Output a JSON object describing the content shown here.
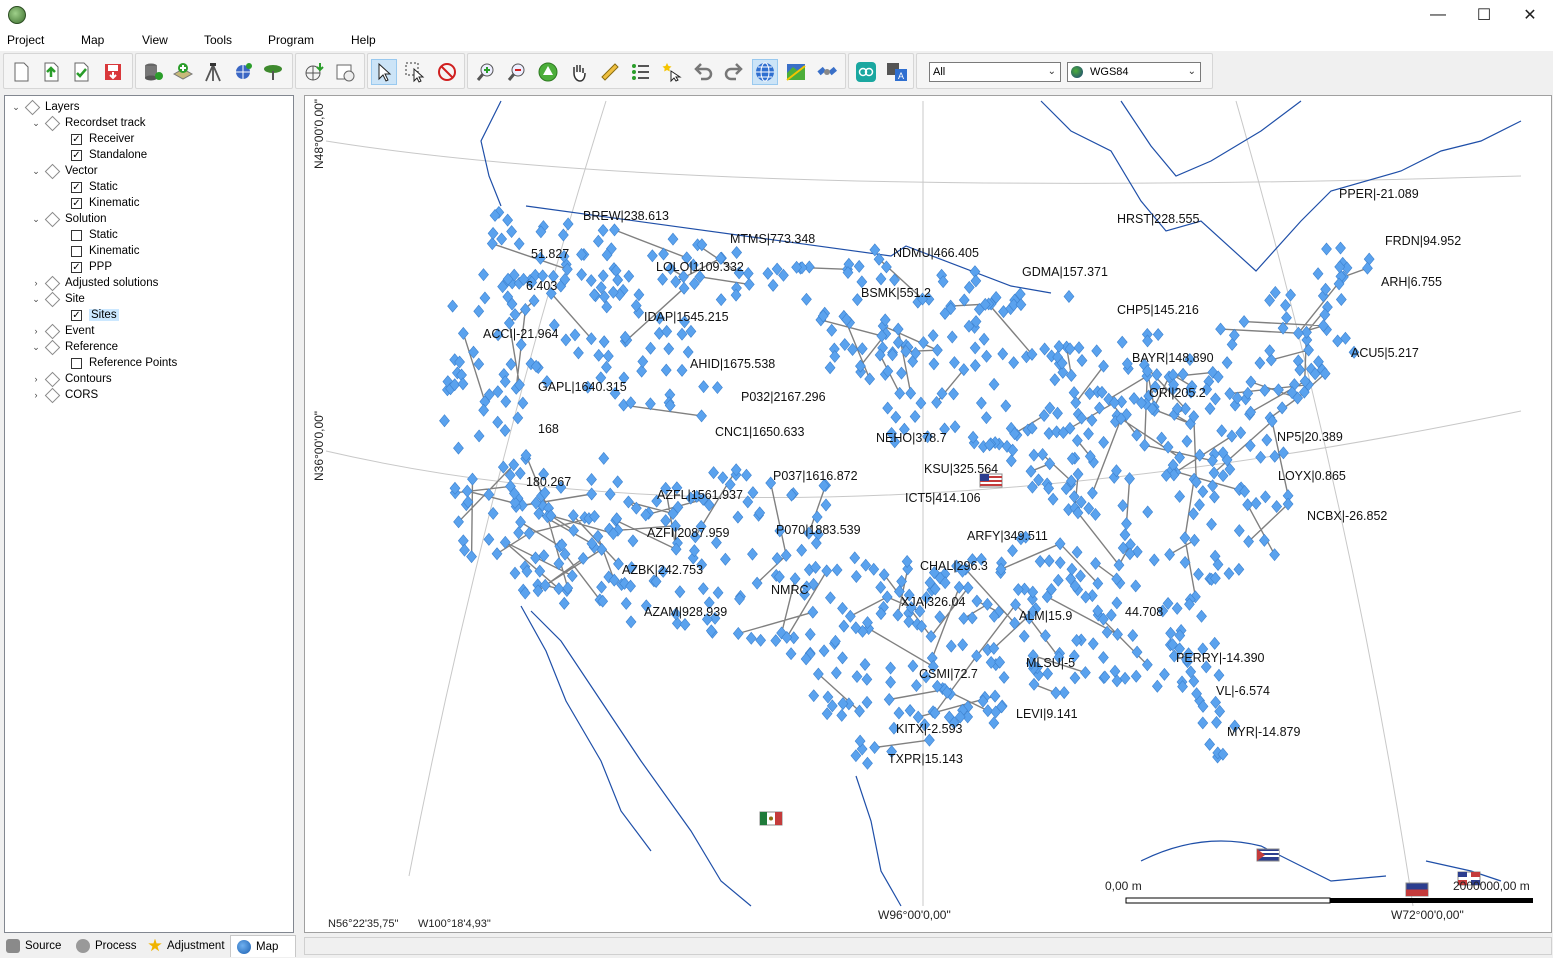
{
  "menu": [
    "Project",
    "Map",
    "View",
    "Tools",
    "Program",
    "Help"
  ],
  "toolbar": {
    "filter_value": "All",
    "crs_value": "WGS84"
  },
  "layers": {
    "root": "Layers",
    "items": [
      {
        "label": "Recordset track",
        "level": 1,
        "type": "group",
        "expanded": true
      },
      {
        "label": "Receiver",
        "level": 2,
        "type": "check",
        "checked": true
      },
      {
        "label": "Standalone",
        "level": 2,
        "type": "check",
        "checked": true
      },
      {
        "label": "Vector",
        "level": 1,
        "type": "group",
        "expanded": true
      },
      {
        "label": "Static",
        "level": 2,
        "type": "check",
        "checked": true
      },
      {
        "label": "Kinematic",
        "level": 2,
        "type": "check",
        "checked": true
      },
      {
        "label": "Solution",
        "level": 1,
        "type": "group",
        "expanded": true
      },
      {
        "label": "Static",
        "level": 2,
        "type": "check",
        "checked": false
      },
      {
        "label": "Kinematic",
        "level": 2,
        "type": "check",
        "checked": false
      },
      {
        "label": "PPP",
        "level": 2,
        "type": "check",
        "checked": true
      },
      {
        "label": "Adjusted solutions",
        "level": 1,
        "type": "group",
        "expanded": false
      },
      {
        "label": "Site",
        "level": 1,
        "type": "group",
        "expanded": true
      },
      {
        "label": "Sites",
        "level": 2,
        "type": "check",
        "checked": true,
        "selected": true
      },
      {
        "label": "Event",
        "level": 1,
        "type": "group",
        "expanded": false
      },
      {
        "label": "Reference",
        "level": 1,
        "type": "group",
        "expanded": true
      },
      {
        "label": "Reference Points",
        "level": 2,
        "type": "check",
        "checked": false
      },
      {
        "label": "Contours",
        "level": 1,
        "type": "group",
        "expanded": false
      },
      {
        "label": "CORS",
        "level": 1,
        "type": "group",
        "expanded": false
      }
    ]
  },
  "tabs": [
    {
      "label": "Source",
      "active": false
    },
    {
      "label": "Process",
      "active": false
    },
    {
      "label": "Adjustment",
      "active": false
    },
    {
      "label": "Map",
      "active": true
    }
  ],
  "map": {
    "graticule_labels": {
      "lat_top": "N48°00'0,00\"",
      "lat_mid": "N36°00'0,00\"",
      "lon_left": "W96°00'0,00\"",
      "lon_right": "W72°00'0,00\""
    },
    "status": {
      "lat": "N56°22'35,75\"",
      "lon": "W100°18'4,93\""
    },
    "scale": {
      "start": "0,00 m",
      "end": "2000000,00 m"
    },
    "site_labels": [
      "BREW|238.613",
      "MTMS|773.348",
      "NDMU|466.405",
      "HRST|228.555",
      "PPER|-21.089",
      "FRDN|94.952",
      "ARH|6.755",
      "GDMA|157.371",
      "LOLO|1109.332",
      "BSMK|551.2",
      "CHP5|145.216",
      "IDAP|1545.215",
      "ACU5|5.217",
      "AHID|1675.538",
      "BAYR|148.890",
      "GAPL|1640.315",
      "P032|2167.296",
      "ORI|205.2",
      "CNC1|1650.633",
      "NEHO|378.7",
      "NP5|20.389",
      "ACCI|-21.964",
      "168",
      "P037|1616.872",
      "KSU|325.564",
      "LOYX|0.865",
      "AZFL|1561.937",
      "ICT5|414.106",
      "NCBX|-26.852",
      "AZFI|2087.959",
      "P070|1883.539",
      "ARFY|349.511",
      "AZBK|242.753",
      "CHAL|296.3",
      "NMRC",
      "XJA|326.04",
      "ALM|15.9",
      "44.708",
      "AZAM|928.939",
      "PERRY|-14.390",
      "CSMI|72.7",
      "MLSU|-5",
      "VL|-6.574",
      "LEVI|9.141",
      "KITX|-2.593",
      "MYR|-14.879",
      "TXPR|15.143",
      "180.267",
      "6.403",
      "51.827"
    ]
  }
}
